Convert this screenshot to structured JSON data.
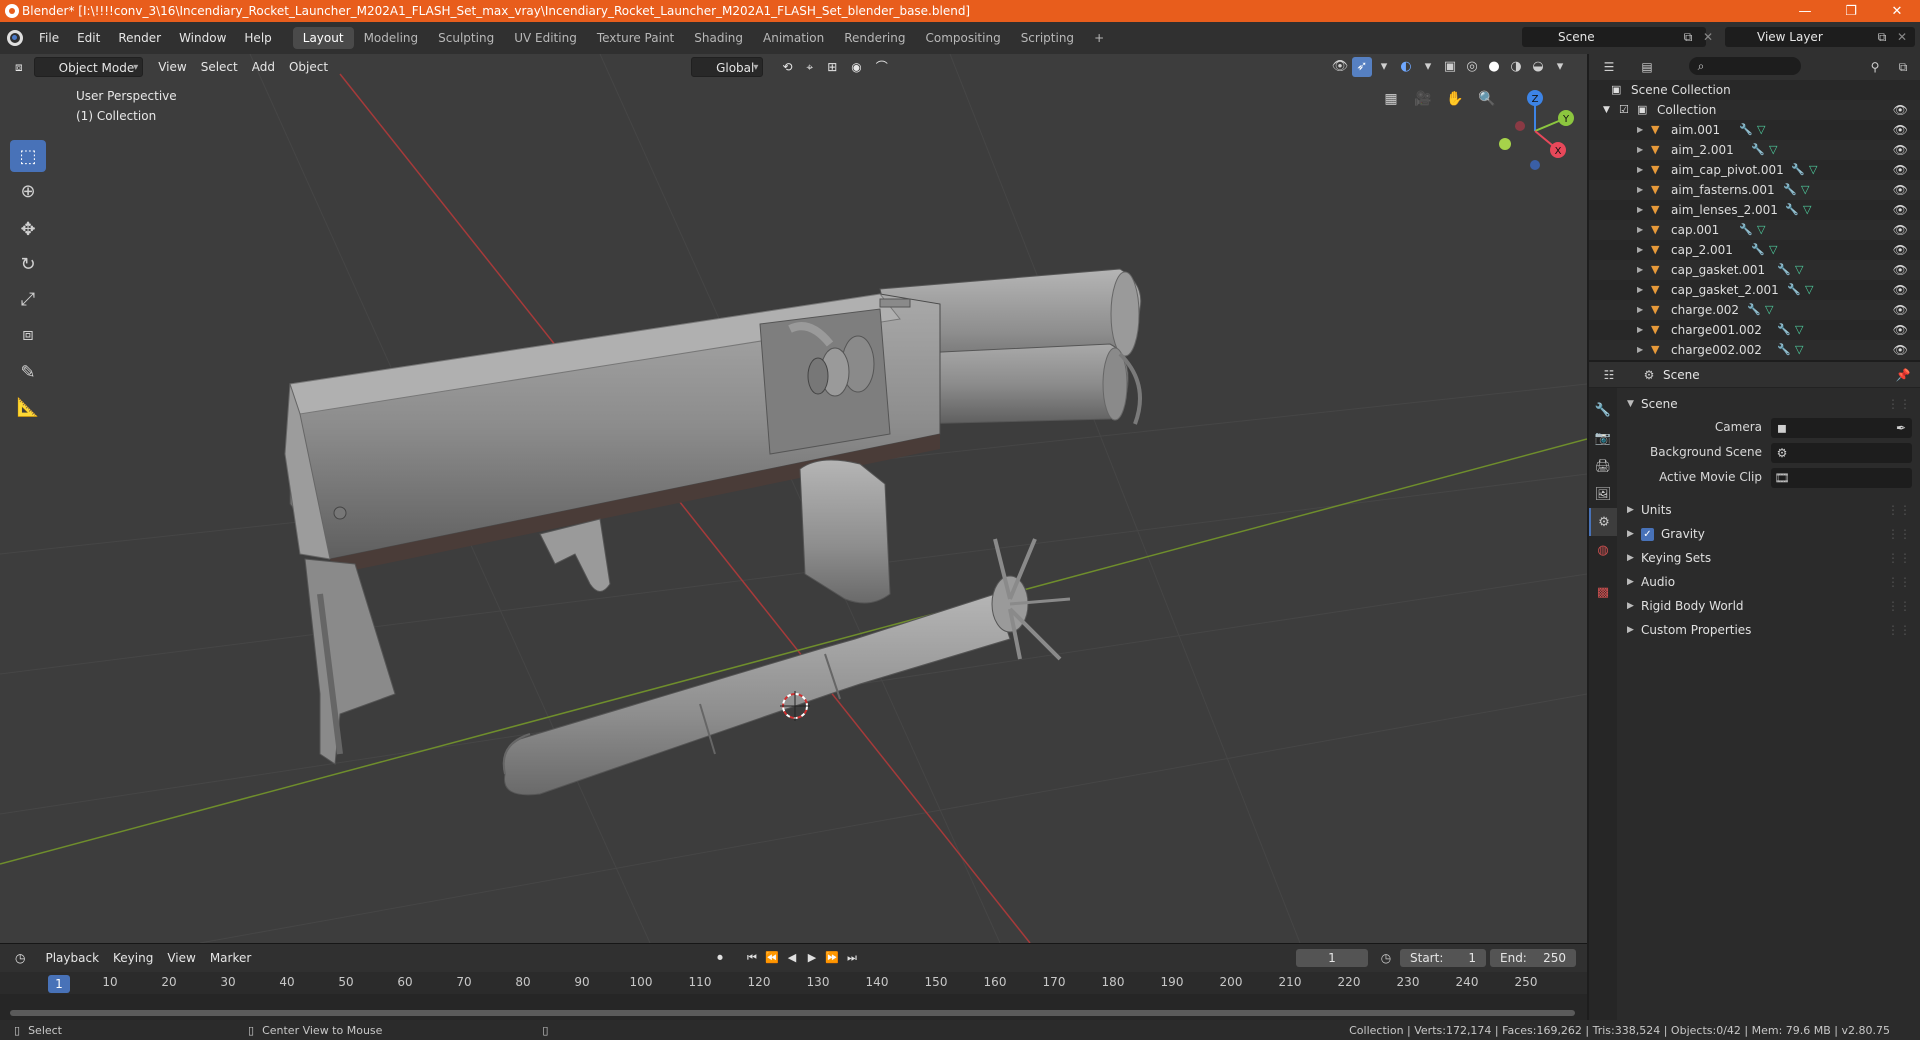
{
  "window": {
    "title": "Blender* [I:\\!!!!conv_3\\16\\Incendiary_Rocket_Launcher_M202A1_FLASH_Set_max_vray\\Incendiary_Rocket_Launcher_M202A1_FLASH_Set_blender_base.blend]",
    "minimize": "—",
    "maximize": "❐",
    "close": "✕"
  },
  "menus": [
    "File",
    "Edit",
    "Render",
    "Window",
    "Help"
  ],
  "workspaces": [
    "Layout",
    "Modeling",
    "Sculpting",
    "UV Editing",
    "Texture Paint",
    "Shading",
    "Animation",
    "Rendering",
    "Compositing",
    "Scripting"
  ],
  "active_workspace": "Layout",
  "add_workspace": "+",
  "scene_name": "Scene",
  "view_layer": "View Layer",
  "viewport": {
    "mode": "Object Mode",
    "menus": [
      "View",
      "Select",
      "Add",
      "Object"
    ],
    "transform_orientation": "Global",
    "info_line1": "User Perspective",
    "info_line2": "(1) Collection",
    "colors": {
      "x_axis": "#e8485a",
      "y_axis": "#8cc63f",
      "z_axis": "#3d84e6",
      "grid": "#444444",
      "bg": "#3d3d3d",
      "x_line": "#b03a3a",
      "y_line": "#6a8a2a"
    }
  },
  "gizmo": {
    "x": "X",
    "y": "Y",
    "z": "Z"
  },
  "timeline": {
    "menus": [
      "Playback",
      "Keying",
      "View",
      "Marker"
    ],
    "current_frame": "1",
    "start_label": "Start:",
    "start": "1",
    "end_label": "End:",
    "end": "250",
    "frame_marks": [
      "10",
      "20",
      "30",
      "40",
      "50",
      "60",
      "70",
      "80",
      "90",
      "100",
      "110",
      "120",
      "130",
      "140",
      "150",
      "160",
      "170",
      "180",
      "190",
      "200",
      "210",
      "220",
      "230",
      "240",
      "250"
    ],
    "current_marker": "1"
  },
  "statusbar": {
    "left_action": "Select",
    "middle_action": "Center View to Mouse",
    "stats": "Collection | Verts:172,174 | Faces:169,262 | Tris:338,524 | Objects:0/42 | Mem: 79.6 MB | v2.80.75"
  },
  "outliner": {
    "root": "Scene Collection",
    "collection": "Collection",
    "items": [
      "aim.001",
      "aim_2.001",
      "aim_cap_pivot.001",
      "aim_fasterns.001",
      "aim_lenses_2.001",
      "cap.001",
      "cap_2.001",
      "cap_gasket.001",
      "cap_gasket_2.001",
      "charge.002",
      "charge001.002",
      "charge002.002"
    ]
  },
  "properties": {
    "context": "Scene",
    "panel_title": "Scene",
    "camera_label": "Camera",
    "background_scene_label": "Background Scene",
    "active_movie_clip_label": "Active Movie Clip",
    "subpanels": [
      "Units",
      "Gravity",
      "Keying Sets",
      "Audio",
      "Rigid Body World",
      "Custom Properties"
    ],
    "gravity_checked": true
  }
}
